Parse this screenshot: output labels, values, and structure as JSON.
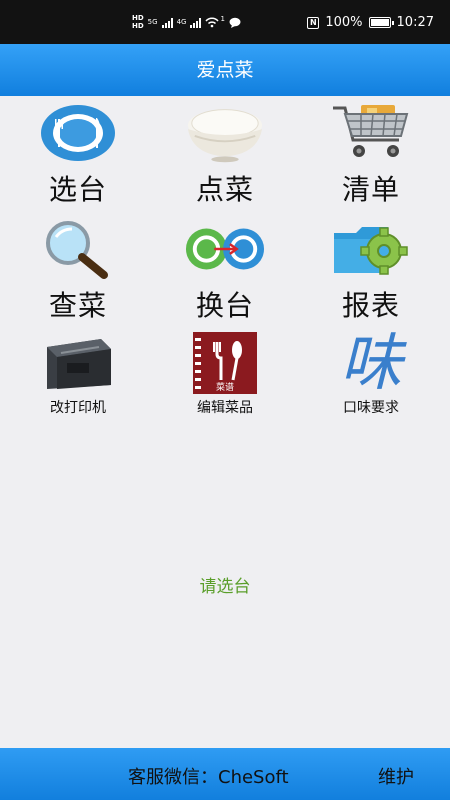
{
  "status_bar": {
    "hd_top": "HD",
    "hd_bottom": "HD",
    "net_5g": "5G",
    "net_4g": "4G",
    "wifi_sup": "1",
    "nfc": "N",
    "battery_percent": "100%",
    "time": "10:27"
  },
  "app": {
    "title": "爱点菜"
  },
  "menu": {
    "select_table": "选台",
    "order": "点菜",
    "bill": "清单",
    "search_dish": "查菜",
    "change_table": "换台",
    "report": "报表",
    "change_printer": "改打印机",
    "edit_dishes": "编辑菜品",
    "taste_request": "口味要求"
  },
  "menu_icon_text": {
    "menu_book": "菜谱",
    "taste_char": "味"
  },
  "prompt": "请选台",
  "footer": {
    "service": "客服微信：CheSoft",
    "maintain": "维护"
  },
  "colors": {
    "title_bar": "#1d8ae6",
    "footer": "#1d8ae6",
    "prompt": "#5a9e2a",
    "background": "#efeff2"
  }
}
